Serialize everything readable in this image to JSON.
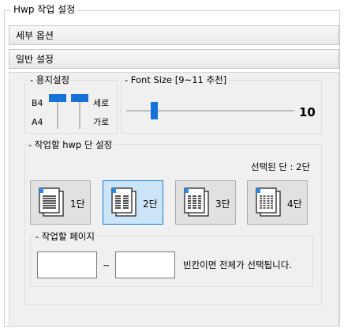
{
  "window": {
    "title": "Hwp 작업 설정"
  },
  "sections": {
    "detail_options": "세부 옵션",
    "general_settings": "일반 설정"
  },
  "paper": {
    "title": "- 용지설정",
    "label_b4": "B4",
    "label_a4": "A4",
    "label_portrait": "세로",
    "label_landscape": "가로"
  },
  "font": {
    "title": "- Font Size [9~11 추천]",
    "value": "10",
    "min": 9,
    "max": 11
  },
  "columns": {
    "title": "- 작업할 hwp 단 설정",
    "selected_text": "선택된 단 : 2단",
    "selected_index": 1,
    "buttons": [
      {
        "label": "1단",
        "icon": "one-column-document-icon"
      },
      {
        "label": "2단",
        "icon": "two-column-document-icon"
      },
      {
        "label": "3단",
        "icon": "three-column-document-icon"
      },
      {
        "label": "4단",
        "icon": "four-column-document-icon"
      }
    ]
  },
  "pages": {
    "title": "- 작업할 페이지",
    "start_value": "",
    "end_value": "",
    "separator": "~",
    "hint": "빈칸이면 전체가 선택됩니다."
  },
  "colors": {
    "accent": "#1672d8",
    "selected_bg": "#cce4f7",
    "panel_bg": "#f0f0f0"
  }
}
